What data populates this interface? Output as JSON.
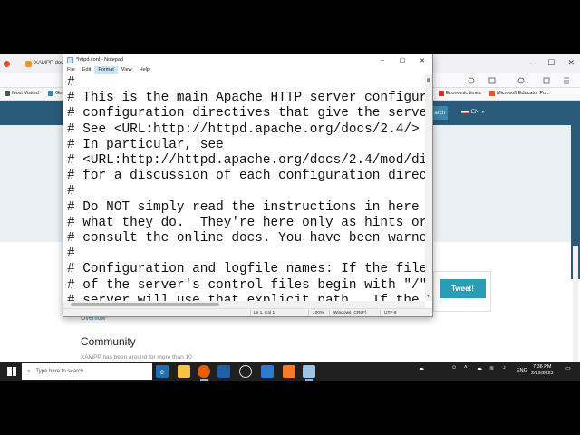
{
  "browser": {
    "tabs": [
      {
        "label": "XAMPP dow"
      }
    ],
    "bookmarks": [
      {
        "label": "Most Visited",
        "color": "#555555"
      },
      {
        "label": "Get",
        "color": "#3a87ad"
      },
      {
        "label": "Economic times",
        "color": "#d32f2f"
      },
      {
        "label": "Microsoft Educator Po...",
        "color": "#f25022"
      }
    ]
  },
  "page": {
    "search_label": "arch",
    "lang": "EN",
    "tweet_label": "Tweet!",
    "overflow_link": "Overflow",
    "community_heading": "Community",
    "xampp_text": "XAMPP has been around for more than 10"
  },
  "notepad": {
    "title": "*httpd.conf - Notepad",
    "menu": [
      "File",
      "Edit",
      "Format",
      "View",
      "Help"
    ],
    "lines": [
      "#",
      "# This is the main Apache HTTP server configura",
      "# configuration directives that give the server",
      "# See <URL:http://httpd.apache.org/docs/2.4/> f",
      "# In particular, see",
      "# <URL:http://httpd.apache.org/docs/2.4/mod/dir",
      "# for a discussion of each configuration direct",
      "#",
      "# Do NOT simply read the instructions in here w",
      "# what they do.  They're here only as hints or",
      "# consult the online docs. You have been warned",
      "#",
      "# Configuration and logfile names: If the filen",
      "# of the server's control files begin with \"/\"",
      "# server will use that explicit path.  If the f"
    ],
    "status": {
      "position": "Ln 1, Col 1",
      "zoom": "100%",
      "line_ending": "Windows (CRLF)",
      "encoding": "UTF-8"
    }
  },
  "taskbar": {
    "search_placeholder": "Type here to search",
    "lang": "ENG",
    "time": "7:36 PM",
    "date": "2/19/2023"
  }
}
